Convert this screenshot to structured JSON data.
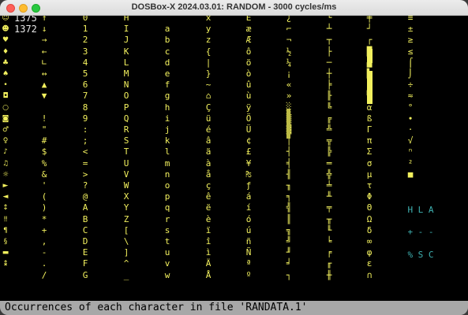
{
  "window": {
    "title": "DOSBox-X 2024.03.01: RANDOM - 3000 cycles/ms"
  },
  "screen": {
    "counts": [
      "1375",
      "1372"
    ],
    "icon_column": [
      "☺",
      "☻",
      "♥",
      "♦",
      "♣",
      "♠",
      "•",
      "◘",
      "○",
      "◙",
      "♂",
      "♀",
      "♪",
      "♫",
      "☼",
      "►",
      "◄",
      "↕",
      "‼",
      "¶",
      "§",
      "▬",
      "↨"
    ],
    "columns": [
      {
        "chars": [
          "↑",
          "↓",
          "→",
          "←",
          "∟",
          "↔",
          "▲",
          "▼",
          " ",
          "!",
          "\"",
          "#",
          "$",
          "%",
          "&",
          "'",
          "(",
          ")",
          "*",
          "+",
          ",",
          "-",
          ".",
          "/"
        ]
      },
      {
        "chars": [
          "0",
          "1",
          "2",
          "3",
          "4",
          "5",
          "6",
          "7",
          "8",
          "9",
          ":",
          ";",
          "<",
          "=",
          ">",
          "?",
          "@",
          "A",
          "B",
          "C",
          "D",
          "E",
          "F",
          "G"
        ]
      },
      {
        "chars": [
          "H",
          "I",
          "J",
          "K",
          "L",
          "M",
          "N",
          "O",
          "P",
          "Q",
          "R",
          "S",
          "T",
          "U",
          "V",
          "W",
          "X",
          "Y",
          "Z",
          "[",
          "\\",
          "]",
          "^",
          "_"
        ]
      },
      {
        "chars": [
          "`",
          "a",
          "b",
          "c",
          "d",
          "e",
          "f",
          "g",
          "h",
          "i",
          "j",
          "k",
          "l",
          "m",
          "n",
          "o",
          "p",
          "q",
          "r",
          "s",
          "t",
          "u",
          "v",
          "w"
        ]
      },
      {
        "chars": [
          "x",
          "y",
          "z",
          "{",
          "|",
          "}",
          "~",
          "⌂",
          "Ç",
          "ü",
          "é",
          "â",
          "ä",
          "à",
          "å",
          "ç",
          "ê",
          "ë",
          "è",
          "ï",
          "î",
          "ì",
          "Ä",
          "Å"
        ]
      },
      {
        "chars": [
          "É",
          "æ",
          "Æ",
          "ô",
          "ö",
          "ò",
          "û",
          "ù",
          "ÿ",
          "Ö",
          "Ü",
          "¢",
          "£",
          "¥",
          "₧",
          "ƒ",
          "á",
          "í",
          "ó",
          "ú",
          "ñ",
          "Ñ",
          "ª",
          "º"
        ]
      },
      {
        "chars": [
          "¿",
          "⌐",
          "¬",
          "½",
          "¼",
          "¡",
          "«",
          "»",
          "░",
          "▒",
          "▓",
          "│",
          "┤",
          "╡",
          "╢",
          "╖",
          "╕",
          "╣",
          "║",
          "╗",
          "╝",
          "╜",
          "╛",
          "┐"
        ]
      },
      {
        "chars": [
          "└",
          "┴",
          "┬",
          "├",
          "─",
          "┼",
          "╞",
          "╟",
          "╚",
          "╔",
          "╩",
          "╦",
          "╠",
          "═",
          "╬",
          "╧",
          "╨",
          "╤",
          "╥",
          "╙",
          "╘",
          "╒",
          "╓",
          "╫"
        ]
      },
      {
        "chars": [
          "╪",
          "┘",
          "┌",
          "█",
          "▄",
          "▌",
          "▐",
          "▀",
          "α",
          "ß",
          "Γ",
          "π",
          "Σ",
          "σ",
          "µ",
          "τ",
          "Φ",
          "Θ",
          "Ω",
          "δ",
          "∞",
          "φ",
          "ε",
          "∩"
        ]
      },
      {
        "chars": [
          "≡",
          "±",
          "≥",
          "≤",
          "⌠",
          "⌡",
          "÷",
          "≈",
          "°",
          "∙",
          "·",
          "√",
          "ⁿ",
          "²",
          "■",
          " "
        ]
      }
    ],
    "cyan_column": [
      "H",
      "+",
      "%"
    ],
    "cyan_column_2": [
      "L",
      "-",
      "S"
    ],
    "cyan_column_3": [
      "A",
      "-",
      "C"
    ]
  },
  "status_bar": {
    "text": "Occurrences of each character in file 'RANDATA.1'"
  },
  "colors": {
    "text_yellow": "#f2f05e",
    "text_cyan": "#3fb3b3",
    "status_bg": "#a8a8a8"
  }
}
